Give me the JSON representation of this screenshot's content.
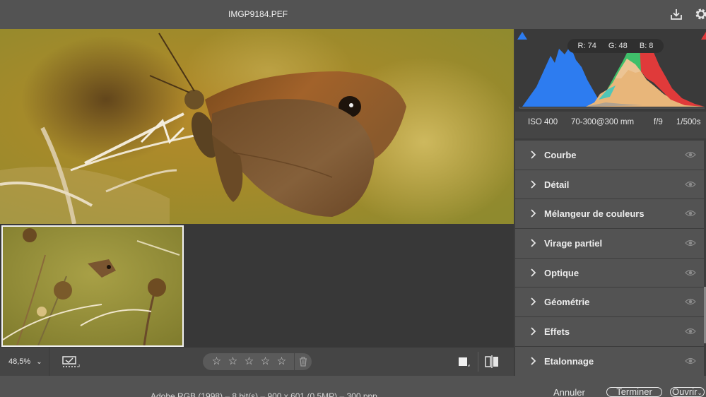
{
  "header": {
    "file_name": "IMGP9184.PEF",
    "save_icon": "download-icon",
    "settings_icon": "gear-icon"
  },
  "histogram": {
    "r_label": "R: 74",
    "g_label": "G: 48",
    "b_label": "B: 8",
    "shadow_clip_icon": "shadow-clipping-icon",
    "highlight_clip_icon": "highlight-clipping-icon"
  },
  "exif": {
    "iso": "ISO 400",
    "lens": "70-300@300 mm",
    "aperture": "f/9",
    "shutter": "1/500s"
  },
  "sections": [
    {
      "label": "Courbe"
    },
    {
      "label": "Détail"
    },
    {
      "label": "Mélangeur de couleurs"
    },
    {
      "label": "Virage partiel"
    },
    {
      "label": "Optique"
    },
    {
      "label": "Géométrie"
    },
    {
      "label": "Effets"
    },
    {
      "label": "Etalonnage"
    }
  ],
  "toolbar": {
    "zoom_value": "48,5%",
    "filmstrip_icon": "filmstrip-toggle-icon",
    "rating_stars": 5,
    "trash_icon": "trash-icon",
    "color_label_icon": "color-label-icon",
    "compare_icon": "before-after-icon"
  },
  "status": {
    "file_info": "Adobe RGB (1998) – 8 bit(s) – 900 x 601 (0,5MP) – 300 ppp",
    "cancel_label": "Annuler",
    "done_label": "Terminer",
    "open_label": "Ouvrir"
  },
  "colors": {
    "accent_blue": "#2d7cf0",
    "accent_red": "#e03a3a"
  }
}
